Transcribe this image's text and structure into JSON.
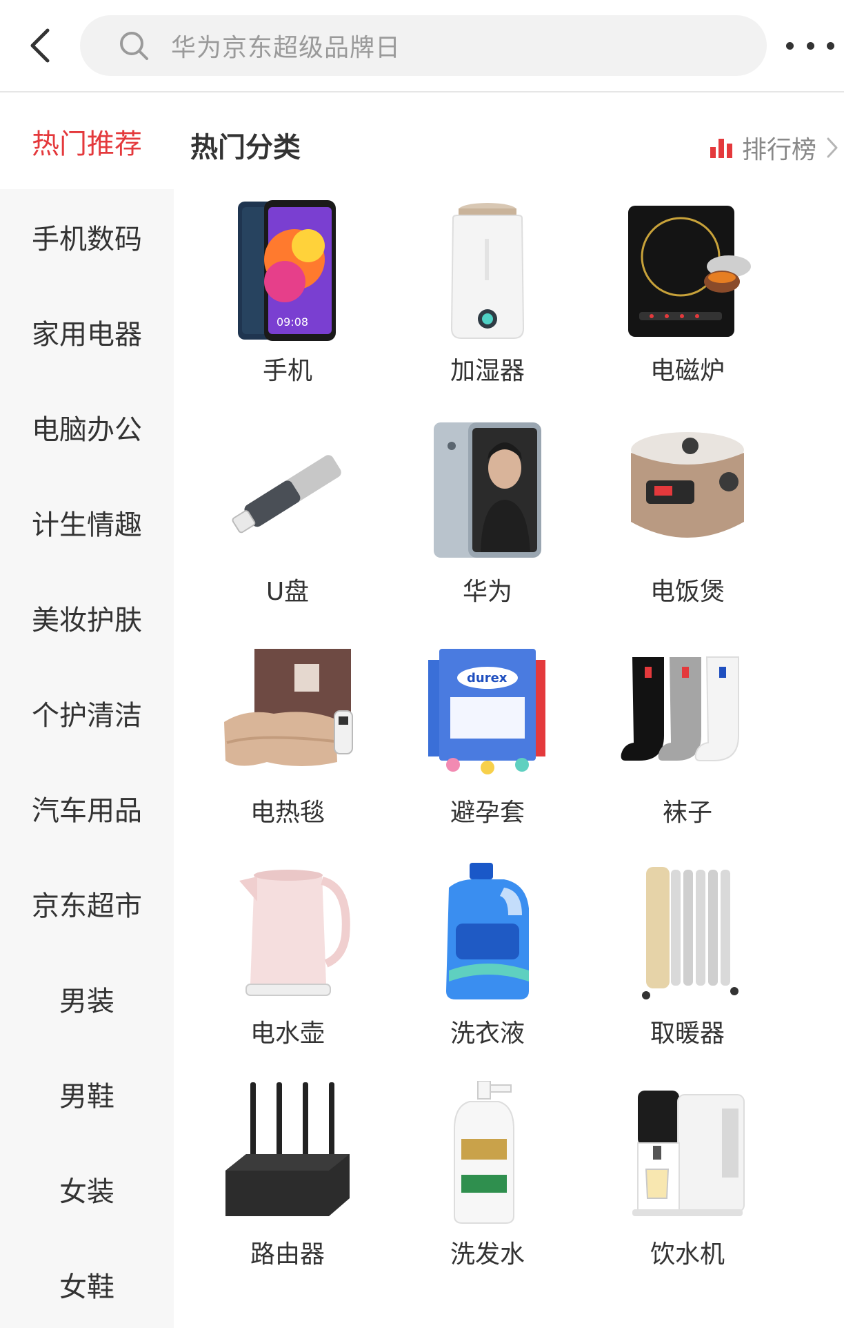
{
  "header": {
    "back_icon": "chevron-left-icon",
    "search_icon": "search-icon",
    "search_placeholder": "华为京东超级品牌日",
    "more_icon": "more-dots-icon"
  },
  "sidebar": {
    "items": [
      {
        "label": "热门推荐",
        "active": true
      },
      {
        "label": "手机数码",
        "active": false
      },
      {
        "label": "家用电器",
        "active": false
      },
      {
        "label": "电脑办公",
        "active": false
      },
      {
        "label": "计生情趣",
        "active": false
      },
      {
        "label": "美妆护肤",
        "active": false
      },
      {
        "label": "个护清洁",
        "active": false
      },
      {
        "label": "汽车用品",
        "active": false
      },
      {
        "label": "京东超市",
        "active": false
      },
      {
        "label": "男装",
        "active": false
      },
      {
        "label": "男鞋",
        "active": false
      },
      {
        "label": "女装",
        "active": false
      },
      {
        "label": "女鞋",
        "active": false
      }
    ]
  },
  "main": {
    "section_title": "热门分类",
    "rank_label": "排行榜",
    "rank_icon": "bar-chart-icon",
    "rank_arrow_icon": "chevron-right-icon",
    "categories": [
      {
        "label": "手机",
        "icon": "phone-icon"
      },
      {
        "label": "加湿器",
        "icon": "humidifier-icon"
      },
      {
        "label": "电磁炉",
        "icon": "induction-cooker-icon"
      },
      {
        "label": "U盘",
        "icon": "usb-drive-icon"
      },
      {
        "label": "华为",
        "icon": "huawei-phone-icon"
      },
      {
        "label": "电饭煲",
        "icon": "rice-cooker-icon"
      },
      {
        "label": "电热毯",
        "icon": "electric-blanket-icon"
      },
      {
        "label": "避孕套",
        "icon": "condom-box-icon"
      },
      {
        "label": "袜子",
        "icon": "socks-icon"
      },
      {
        "label": "电水壶",
        "icon": "kettle-icon"
      },
      {
        "label": "洗衣液",
        "icon": "detergent-icon"
      },
      {
        "label": "取暖器",
        "icon": "heater-icon"
      },
      {
        "label": "路由器",
        "icon": "router-icon"
      },
      {
        "label": "洗发水",
        "icon": "shampoo-icon"
      },
      {
        "label": "饮水机",
        "icon": "water-dispenser-icon"
      }
    ]
  },
  "colors": {
    "accent": "#e4393c",
    "sidebar_bg": "#f7f7f7",
    "search_bg": "#f2f2f2",
    "text": "#333333",
    "muted": "#888888"
  }
}
